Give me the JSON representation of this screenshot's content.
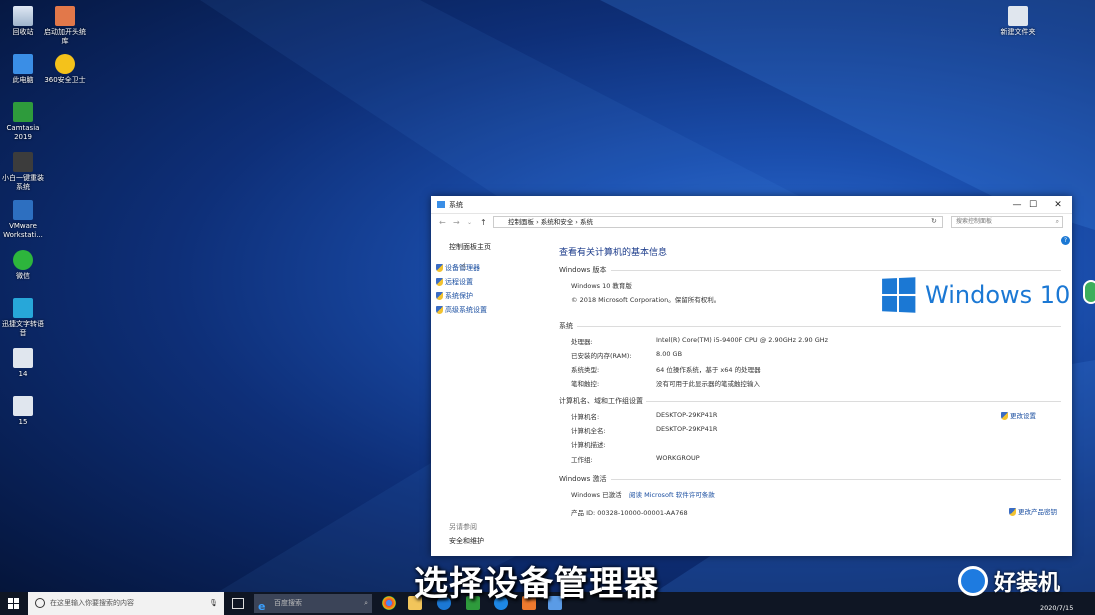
{
  "desktop": {
    "icons": [
      {
        "label": "回收站"
      },
      {
        "label": "启动加开头统库"
      },
      {
        "label": "此电脑"
      },
      {
        "label": "360安全卫士"
      },
      {
        "label": "Camtasia 2019"
      },
      {
        "label": "小白一键重装系统"
      },
      {
        "label": "VMware Workstati..."
      },
      {
        "label": "微信"
      },
      {
        "label": "迅捷文字转语音"
      },
      {
        "label": "14"
      },
      {
        "label": "15"
      },
      {
        "label": "新建文件夹"
      }
    ]
  },
  "window": {
    "title": "系统",
    "controls": {
      "minimize": "—",
      "maximize": "☐",
      "close": "✕"
    },
    "address": {
      "crumbs": "控制面板 › 系统和安全 › 系统",
      "search_placeholder": "搜索控制面板"
    },
    "left_nav": {
      "home": "控制面板主页",
      "links": [
        "设备管理器",
        "远程设置",
        "系统保护",
        "高级系统设置"
      ],
      "see_also_title": "另请参阅",
      "see_also": "安全和维护"
    },
    "main": {
      "heading": "查看有关计算机的基本信息",
      "edition_title": "Windows 版本",
      "edition": "Windows 10 教育版",
      "copyright": "© 2018 Microsoft Corporation。保留所有权利。",
      "logo_text": "Windows 10",
      "system_title": "系统",
      "system_rows": [
        {
          "label": "处理器:",
          "value": "Intel(R) Core(TM) i5-9400F CPU @ 2.90GHz   2.90 GHz"
        },
        {
          "label": "已安装的内存(RAM):",
          "value": "8.00 GB"
        },
        {
          "label": "系统类型:",
          "value": "64 位操作系统，基于 x64 的处理器"
        },
        {
          "label": "笔和触控:",
          "value": "没有可用于此显示器的笔或触控输入"
        }
      ],
      "computer_title": "计算机名、域和工作组设置",
      "computer_rows": [
        {
          "label": "计算机名:",
          "value": "DESKTOP-29KP41R"
        },
        {
          "label": "计算机全名:",
          "value": "DESKTOP-29KP41R"
        },
        {
          "label": "计算机描述:",
          "value": ""
        },
        {
          "label": "工作组:",
          "value": "WORKGROUP"
        }
      ],
      "change_settings": "更改设置",
      "activation_title": "Windows 激活",
      "activation_status": "Windows 已激活",
      "activation_link": "阅读 Microsoft 软件许可条款",
      "product_id": "产品 ID: 00328-10000-00001-AA768",
      "change_key": "更改产品密钥"
    }
  },
  "taskbar": {
    "search_placeholder": "在这里输入你要搜索的内容",
    "browser_search": "百度搜索",
    "date": "2020/7/15"
  },
  "overlay": {
    "caption": "选择设备管理器",
    "brand": "好装机"
  },
  "colors": {
    "link": "#1a4ea0",
    "win_logo": "#1b78d4",
    "taskbar": "#0f1624"
  }
}
